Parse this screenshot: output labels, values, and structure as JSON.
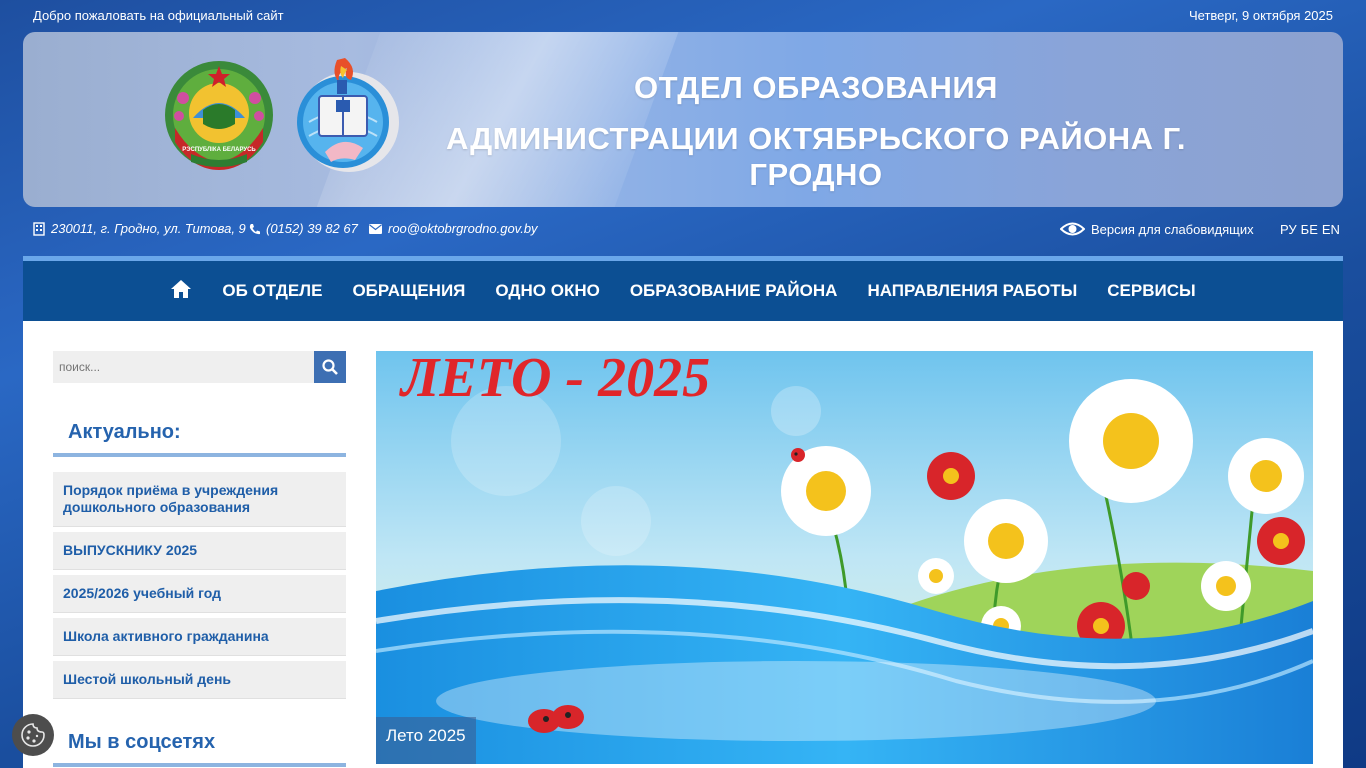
{
  "topbar": {
    "welcome": "Добро пожаловать на официальный сайт",
    "date": "Четверг, 9 октября 2025"
  },
  "header": {
    "title_line1": "ОТДЕЛ ОБРАЗОВАНИЯ",
    "title_line2": "АДМИНИСТРАЦИИ ОКТЯБРЬСКОГО РАЙОНА Г. ГРОДНО",
    "emblem_text": "РЭСПУБЛІКА БЕЛАРУСЬ"
  },
  "contacts": {
    "address": "230011, г. Гродно, ул. Титова, 9",
    "phone": "(0152) 39 82 67",
    "email": "roo@oktobrgrodno.gov.by",
    "vision_label": "Версия для слабовидящих",
    "languages": [
      "РУ",
      "БЕ",
      "EN"
    ]
  },
  "nav": {
    "items": [
      "ОБ ОТДЕЛЕ",
      "ОБРАЩЕНИЯ",
      "ОДНО ОКНО",
      "ОБРАЗОВАНИЕ РАЙОНА",
      "НАПРАВЛЕНИЯ РАБОТЫ",
      "СЕРВИСЫ"
    ]
  },
  "sidebar": {
    "search_placeholder": "поиск...",
    "actual_title": "Актуально:",
    "links": [
      "Порядок приёма в учреждения дошкольного образования",
      "ВЫПУСКНИКУ 2025",
      "2025/2026 учебный год",
      "Школа активного гражданина",
      "Шестой школьный день"
    ],
    "social_title": "Мы в соцсетях"
  },
  "slider": {
    "banner_text": "ЛЕТО - 2025",
    "caption": "Лето 2025"
  },
  "colors": {
    "nav_bg": "#0c4f93",
    "accent": "#2563ae",
    "search_button": "#3d6fb3"
  },
  "icons": [
    "home-icon",
    "building-icon",
    "phone-icon",
    "envelope-icon",
    "eye-icon",
    "search-icon",
    "cookie-icon"
  ]
}
